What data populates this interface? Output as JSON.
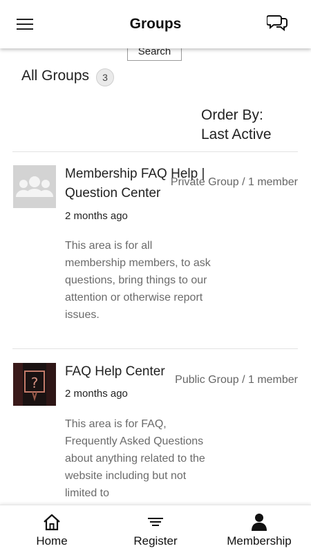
{
  "header": {
    "title": "Groups",
    "menu_icon": "hamburger-menu-icon",
    "chat_icon": "chat-bubbles-icon"
  },
  "search": {
    "button_label": "Search"
  },
  "filter": {
    "all_groups_label": "All Groups",
    "count": "3",
    "order_by_label": "Order By:",
    "order_by_value": "Last Active"
  },
  "groups": [
    {
      "name_line1": "Membership FAQ Help |",
      "name_line2": "Question Center",
      "meta": "Private Group / 1 member",
      "time": "2 months ago",
      "description": "This area is for all membership members, to ask questions, bring things to our attention or otherwise report issues.",
      "thumb_icon": "group-placeholder-icon"
    },
    {
      "name_line1": "FAQ Help Center",
      "meta": "Public Group / 1 member",
      "time": "2 months ago",
      "description": "This area is for FAQ, Frequently Asked Questions about anything related to the website including but not limited to",
      "thumb_icon": "question-sign-photo"
    }
  ],
  "tabbar": {
    "tabs": [
      {
        "label": "Home",
        "icon": "home-icon"
      },
      {
        "label": "Register",
        "icon": "list-icon"
      },
      {
        "label": "Membership",
        "icon": "person-icon"
      }
    ]
  },
  "colors": {
    "text_primary": "#222222",
    "text_secondary": "#6a6a6a",
    "divider": "#e3e3e3",
    "badge_bg": "#eaeaea"
  }
}
